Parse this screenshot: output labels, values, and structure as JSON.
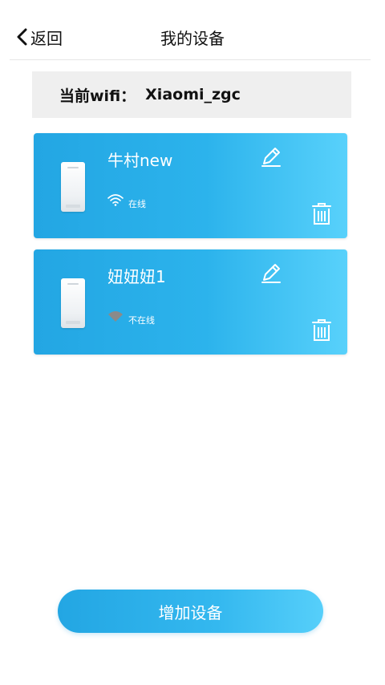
{
  "header": {
    "back_label": "返回",
    "title": "我的设备"
  },
  "wifi": {
    "label": "当前wifi：",
    "ssid": "Xiaomi_zgc"
  },
  "devices": [
    {
      "name": "牛村new",
      "status": "在线",
      "wifi_icon": "wifi-online-icon"
    },
    {
      "name": "妞妞妞1",
      "status": "不在线",
      "wifi_icon": "wifi-offline-icon"
    }
  ],
  "add_button_label": "增加设备",
  "colors": {
    "card_start": "#23a6e3",
    "card_end": "#58d1fb",
    "offline_icon": "#8a8a8a"
  }
}
